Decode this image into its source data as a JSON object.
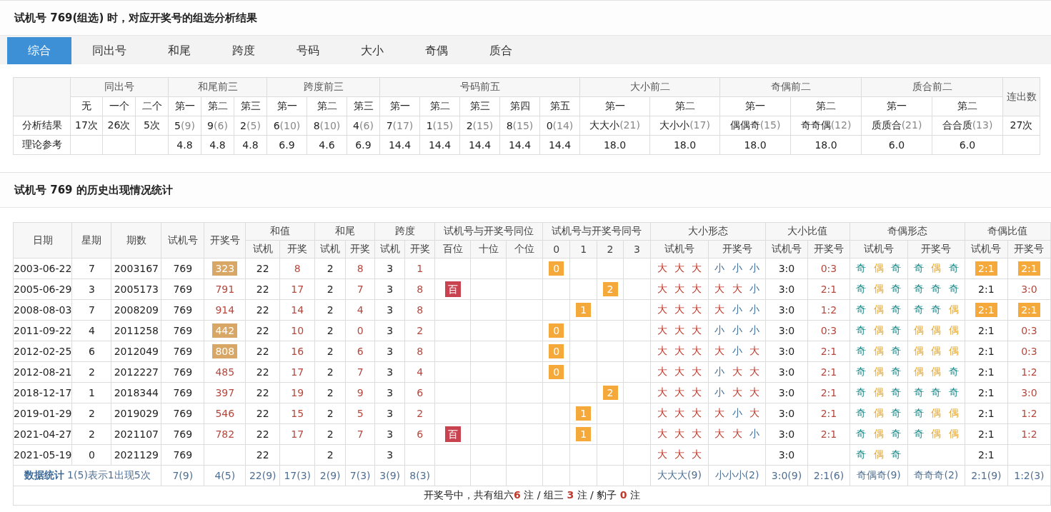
{
  "analysis": {
    "title": "试机号 769(组选) 时，对应开奖号的组选分析结果",
    "tabs": [
      {
        "label": "综合",
        "selected": true
      },
      {
        "label": "同出号",
        "selected": false
      },
      {
        "label": "和尾",
        "selected": false
      },
      {
        "label": "跨度",
        "selected": false
      },
      {
        "label": "号码",
        "selected": false
      },
      {
        "label": "大小",
        "selected": false
      },
      {
        "label": "奇偶",
        "selected": false
      },
      {
        "label": "质合",
        "selected": false
      }
    ],
    "groups": [
      {
        "label": "同出号",
        "columns": [
          "无",
          "一个",
          "二个"
        ]
      },
      {
        "label": "和尾前三",
        "columns": [
          "第一",
          "第二",
          "第三"
        ]
      },
      {
        "label": "跨度前三",
        "columns": [
          "第一",
          "第二",
          "第三"
        ]
      },
      {
        "label": "号码前五",
        "columns": [
          "第一",
          "第二",
          "第三",
          "第四",
          "第五"
        ]
      },
      {
        "label": "大小前二",
        "columns": [
          "第一",
          "第二"
        ]
      },
      {
        "label": "奇偶前二",
        "columns": [
          "第一",
          "第二"
        ]
      },
      {
        "label": "质合前二",
        "columns": [
          "第一",
          "第二"
        ]
      },
      {
        "label": "连出数"
      }
    ],
    "result_label": "分析结果",
    "theory_label": "理论参考",
    "results": [
      {
        "value": "17次"
      },
      {
        "value": "26次"
      },
      {
        "value": "5次"
      },
      {
        "value": "5",
        "count": "(9)",
        "theory": "4.8"
      },
      {
        "value": "9",
        "count": "(6)",
        "theory": "4.8"
      },
      {
        "value": "2",
        "count": "(5)",
        "theory": "4.8"
      },
      {
        "value": "6",
        "count": "(10)",
        "theory": "6.9"
      },
      {
        "value": "8",
        "count": "(10)",
        "theory": "4.6"
      },
      {
        "value": "4",
        "count": "(6)",
        "theory": "6.9"
      },
      {
        "value": "7",
        "count": "(17)",
        "theory": "14.4"
      },
      {
        "value": "1",
        "count": "(15)",
        "theory": "14.4"
      },
      {
        "value": "2",
        "count": "(15)",
        "theory": "14.4"
      },
      {
        "value": "8",
        "count": "(15)",
        "theory": "14.4"
      },
      {
        "value": "0",
        "count": "(14)",
        "theory": "14.4"
      },
      {
        "value": "大大小",
        "count": "(21)",
        "theory": "18.0"
      },
      {
        "value": "大小小",
        "count": "(17)",
        "theory": "18.0"
      },
      {
        "value": "偶偶奇",
        "count": "(15)",
        "theory": "18.0"
      },
      {
        "value": "奇奇偶",
        "count": "(12)",
        "theory": "18.0"
      },
      {
        "value": "质质合",
        "count": "(21)",
        "theory": "6.0"
      },
      {
        "value": "合合质",
        "count": "(13)",
        "theory": "6.0"
      },
      {
        "value": "27次"
      }
    ]
  },
  "history": {
    "title": "试机号 769 的历史出现情况统计",
    "header_groups": [
      {
        "label": "日期"
      },
      {
        "label": "星期"
      },
      {
        "label": "期数"
      },
      {
        "label": "试机号"
      },
      {
        "label": "开奖号"
      },
      {
        "label": "和值",
        "columns": [
          "试机",
          "开奖"
        ]
      },
      {
        "label": "和尾",
        "columns": [
          "试机",
          "开奖"
        ]
      },
      {
        "label": "跨度",
        "columns": [
          "试机",
          "开奖"
        ]
      },
      {
        "label": "试机号与开奖号同位",
        "columns": [
          "百位",
          "十位",
          "个位"
        ]
      },
      {
        "label": "试机号与开奖号同号",
        "columns": [
          "0",
          "1",
          "2",
          "3"
        ]
      },
      {
        "label": "大小形态",
        "columns": [
          "试机号",
          "开奖号"
        ]
      },
      {
        "label": "大小比值",
        "columns": [
          "试机号",
          "开奖号"
        ]
      },
      {
        "label": "奇偶形态",
        "columns": [
          "试机号",
          "开奖号"
        ]
      },
      {
        "label": "奇偶比值",
        "columns": [
          "试机号",
          "开奖号"
        ]
      }
    ],
    "rows": [
      {
        "date": "2003-06-22",
        "weekday": "7",
        "issue": "2003167",
        "trial": "769",
        "draw": {
          "text": "323",
          "highlight": true
        },
        "sum": {
          "trial": "22",
          "draw": "8"
        },
        "tail": {
          "trial": "2",
          "draw": "8"
        },
        "span": {
          "trial": "3",
          "draw": "1"
        },
        "same_number": {
          "zero": "0"
        },
        "size_trial": [
          {
            "text": "大",
            "kind": "big"
          },
          {
            "text": "大",
            "kind": "big"
          },
          {
            "text": "大",
            "kind": "big"
          }
        ],
        "size_draw": [
          {
            "text": "小",
            "kind": "small"
          },
          {
            "text": "小",
            "kind": "small"
          },
          {
            "text": "小",
            "kind": "small"
          }
        ],
        "size_ratio": {
          "trial": "3:0",
          "draw": "0:3"
        },
        "parity_trial": [
          {
            "text": "奇",
            "kind": "odd"
          },
          {
            "text": "偶",
            "kind": "even"
          },
          {
            "text": "奇",
            "kind": "odd"
          }
        ],
        "parity_draw": [
          {
            "text": "奇",
            "kind": "odd"
          },
          {
            "text": "偶",
            "kind": "even"
          },
          {
            "text": "奇",
            "kind": "odd"
          }
        ],
        "parity_ratio": {
          "trial": {
            "text": "2:1",
            "highlight": true
          },
          "draw": {
            "text": "2:1",
            "highlight": true
          }
        }
      },
      {
        "date": "2005-06-29",
        "weekday": "3",
        "issue": "2005173",
        "trial": "769",
        "draw": {
          "text": "791",
          "highlight": false
        },
        "sum": {
          "trial": "22",
          "draw": "17"
        },
        "tail": {
          "trial": "2",
          "draw": "7"
        },
        "span": {
          "trial": "3",
          "draw": "8"
        },
        "same_position": {
          "hundreds": "百"
        },
        "same_number": {
          "two": "2"
        },
        "size_trial": [
          {
            "text": "大",
            "kind": "big"
          },
          {
            "text": "大",
            "kind": "big"
          },
          {
            "text": "大",
            "kind": "big"
          }
        ],
        "size_draw": [
          {
            "text": "大",
            "kind": "big"
          },
          {
            "text": "大",
            "kind": "big"
          },
          {
            "text": "小",
            "kind": "small"
          }
        ],
        "size_ratio": {
          "trial": "3:0",
          "draw": "2:1"
        },
        "parity_trial": [
          {
            "text": "奇",
            "kind": "odd"
          },
          {
            "text": "偶",
            "kind": "even"
          },
          {
            "text": "奇",
            "kind": "odd"
          }
        ],
        "parity_draw": [
          {
            "text": "奇",
            "kind": "odd"
          },
          {
            "text": "奇",
            "kind": "odd"
          },
          {
            "text": "奇",
            "kind": "odd"
          }
        ],
        "parity_ratio": {
          "trial": {
            "text": "2:1",
            "highlight": false
          },
          "draw": {
            "text": "3:0",
            "highlight": false
          }
        }
      },
      {
        "date": "2008-08-03",
        "weekday": "7",
        "issue": "2008209",
        "trial": "769",
        "draw": {
          "text": "914",
          "highlight": false
        },
        "sum": {
          "trial": "22",
          "draw": "14"
        },
        "tail": {
          "trial": "2",
          "draw": "4"
        },
        "span": {
          "trial": "3",
          "draw": "8"
        },
        "same_number": {
          "one": "1"
        },
        "size_trial": [
          {
            "text": "大",
            "kind": "big"
          },
          {
            "text": "大",
            "kind": "big"
          },
          {
            "text": "大",
            "kind": "big"
          }
        ],
        "size_draw": [
          {
            "text": "大",
            "kind": "big"
          },
          {
            "text": "小",
            "kind": "small"
          },
          {
            "text": "小",
            "kind": "small"
          }
        ],
        "size_ratio": {
          "trial": "3:0",
          "draw": "1:2"
        },
        "parity_trial": [
          {
            "text": "奇",
            "kind": "odd"
          },
          {
            "text": "偶",
            "kind": "even"
          },
          {
            "text": "奇",
            "kind": "odd"
          }
        ],
        "parity_draw": [
          {
            "text": "奇",
            "kind": "odd"
          },
          {
            "text": "奇",
            "kind": "odd"
          },
          {
            "text": "偶",
            "kind": "even"
          }
        ],
        "parity_ratio": {
          "trial": {
            "text": "2:1",
            "highlight": true
          },
          "draw": {
            "text": "2:1",
            "highlight": true
          }
        }
      },
      {
        "date": "2011-09-22",
        "weekday": "4",
        "issue": "2011258",
        "trial": "769",
        "draw": {
          "text": "442",
          "highlight": true
        },
        "sum": {
          "trial": "22",
          "draw": "10"
        },
        "tail": {
          "trial": "2",
          "draw": "0"
        },
        "span": {
          "trial": "3",
          "draw": "2"
        },
        "same_number": {
          "zero": "0"
        },
        "size_trial": [
          {
            "text": "大",
            "kind": "big"
          },
          {
            "text": "大",
            "kind": "big"
          },
          {
            "text": "大",
            "kind": "big"
          }
        ],
        "size_draw": [
          {
            "text": "小",
            "kind": "small"
          },
          {
            "text": "小",
            "kind": "small"
          },
          {
            "text": "小",
            "kind": "small"
          }
        ],
        "size_ratio": {
          "trial": "3:0",
          "draw": "0:3"
        },
        "parity_trial": [
          {
            "text": "奇",
            "kind": "odd"
          },
          {
            "text": "偶",
            "kind": "even"
          },
          {
            "text": "奇",
            "kind": "odd"
          }
        ],
        "parity_draw": [
          {
            "text": "偶",
            "kind": "even"
          },
          {
            "text": "偶",
            "kind": "even"
          },
          {
            "text": "偶",
            "kind": "even"
          }
        ],
        "parity_ratio": {
          "trial": {
            "text": "2:1",
            "highlight": false
          },
          "draw": {
            "text": "0:3",
            "highlight": false
          }
        }
      },
      {
        "date": "2012-02-25",
        "weekday": "6",
        "issue": "2012049",
        "trial": "769",
        "draw": {
          "text": "808",
          "highlight": true
        },
        "sum": {
          "trial": "22",
          "draw": "16"
        },
        "tail": {
          "trial": "2",
          "draw": "6"
        },
        "span": {
          "trial": "3",
          "draw": "8"
        },
        "same_number": {
          "zero": "0"
        },
        "size_trial": [
          {
            "text": "大",
            "kind": "big"
          },
          {
            "text": "大",
            "kind": "big"
          },
          {
            "text": "大",
            "kind": "big"
          }
        ],
        "size_draw": [
          {
            "text": "大",
            "kind": "big"
          },
          {
            "text": "小",
            "kind": "small"
          },
          {
            "text": "大",
            "kind": "big"
          }
        ],
        "size_ratio": {
          "trial": "3:0",
          "draw": "2:1"
        },
        "parity_trial": [
          {
            "text": "奇",
            "kind": "odd"
          },
          {
            "text": "偶",
            "kind": "even"
          },
          {
            "text": "奇",
            "kind": "odd"
          }
        ],
        "parity_draw": [
          {
            "text": "偶",
            "kind": "even"
          },
          {
            "text": "偶",
            "kind": "even"
          },
          {
            "text": "偶",
            "kind": "even"
          }
        ],
        "parity_ratio": {
          "trial": {
            "text": "2:1",
            "highlight": false
          },
          "draw": {
            "text": "0:3",
            "highlight": false
          }
        }
      },
      {
        "date": "2012-08-21",
        "weekday": "2",
        "issue": "2012227",
        "trial": "769",
        "draw": {
          "text": "485",
          "highlight": false
        },
        "sum": {
          "trial": "22",
          "draw": "17"
        },
        "tail": {
          "trial": "2",
          "draw": "7"
        },
        "span": {
          "trial": "3",
          "draw": "4"
        },
        "same_number": {
          "zero": "0"
        },
        "size_trial": [
          {
            "text": "大",
            "kind": "big"
          },
          {
            "text": "大",
            "kind": "big"
          },
          {
            "text": "大",
            "kind": "big"
          }
        ],
        "size_draw": [
          {
            "text": "小",
            "kind": "small"
          },
          {
            "text": "大",
            "kind": "big"
          },
          {
            "text": "大",
            "kind": "big"
          }
        ],
        "size_ratio": {
          "trial": "3:0",
          "draw": "2:1"
        },
        "parity_trial": [
          {
            "text": "奇",
            "kind": "odd"
          },
          {
            "text": "偶",
            "kind": "even"
          },
          {
            "text": "奇",
            "kind": "odd"
          }
        ],
        "parity_draw": [
          {
            "text": "偶",
            "kind": "even"
          },
          {
            "text": "偶",
            "kind": "even"
          },
          {
            "text": "奇",
            "kind": "odd"
          }
        ],
        "parity_ratio": {
          "trial": {
            "text": "2:1",
            "highlight": false
          },
          "draw": {
            "text": "1:2",
            "highlight": false
          }
        }
      },
      {
        "date": "2018-12-17",
        "weekday": "1",
        "issue": "2018344",
        "trial": "769",
        "draw": {
          "text": "397",
          "highlight": false
        },
        "sum": {
          "trial": "22",
          "draw": "19"
        },
        "tail": {
          "trial": "2",
          "draw": "9"
        },
        "span": {
          "trial": "3",
          "draw": "6"
        },
        "same_number": {
          "two": "2"
        },
        "size_trial": [
          {
            "text": "大",
            "kind": "big"
          },
          {
            "text": "大",
            "kind": "big"
          },
          {
            "text": "大",
            "kind": "big"
          }
        ],
        "size_draw": [
          {
            "text": "小",
            "kind": "small"
          },
          {
            "text": "大",
            "kind": "big"
          },
          {
            "text": "大",
            "kind": "big"
          }
        ],
        "size_ratio": {
          "trial": "3:0",
          "draw": "2:1"
        },
        "parity_trial": [
          {
            "text": "奇",
            "kind": "odd"
          },
          {
            "text": "偶",
            "kind": "even"
          },
          {
            "text": "奇",
            "kind": "odd"
          }
        ],
        "parity_draw": [
          {
            "text": "奇",
            "kind": "odd"
          },
          {
            "text": "奇",
            "kind": "odd"
          },
          {
            "text": "奇",
            "kind": "odd"
          }
        ],
        "parity_ratio": {
          "trial": {
            "text": "2:1",
            "highlight": false
          },
          "draw": {
            "text": "3:0",
            "highlight": false
          }
        }
      },
      {
        "date": "2019-01-29",
        "weekday": "2",
        "issue": "2019029",
        "trial": "769",
        "draw": {
          "text": "546",
          "highlight": false
        },
        "sum": {
          "trial": "22",
          "draw": "15"
        },
        "tail": {
          "trial": "2",
          "draw": "5"
        },
        "span": {
          "trial": "3",
          "draw": "2"
        },
        "same_number": {
          "one": "1"
        },
        "size_trial": [
          {
            "text": "大",
            "kind": "big"
          },
          {
            "text": "大",
            "kind": "big"
          },
          {
            "text": "大",
            "kind": "big"
          }
        ],
        "size_draw": [
          {
            "text": "大",
            "kind": "big"
          },
          {
            "text": "小",
            "kind": "small"
          },
          {
            "text": "大",
            "kind": "big"
          }
        ],
        "size_ratio": {
          "trial": "3:0",
          "draw": "2:1"
        },
        "parity_trial": [
          {
            "text": "奇",
            "kind": "odd"
          },
          {
            "text": "偶",
            "kind": "even"
          },
          {
            "text": "奇",
            "kind": "odd"
          }
        ],
        "parity_draw": [
          {
            "text": "奇",
            "kind": "odd"
          },
          {
            "text": "偶",
            "kind": "even"
          },
          {
            "text": "偶",
            "kind": "even"
          }
        ],
        "parity_ratio": {
          "trial": {
            "text": "2:1",
            "highlight": false
          },
          "draw": {
            "text": "1:2",
            "highlight": false
          }
        }
      },
      {
        "date": "2021-04-27",
        "weekday": "2",
        "issue": "2021107",
        "trial": "769",
        "draw": {
          "text": "782",
          "highlight": false
        },
        "sum": {
          "trial": "22",
          "draw": "17"
        },
        "tail": {
          "trial": "2",
          "draw": "7"
        },
        "span": {
          "trial": "3",
          "draw": "6"
        },
        "same_position": {
          "hundreds": "百"
        },
        "same_number": {
          "one": "1"
        },
        "size_trial": [
          {
            "text": "大",
            "kind": "big"
          },
          {
            "text": "大",
            "kind": "big"
          },
          {
            "text": "大",
            "kind": "big"
          }
        ],
        "size_draw": [
          {
            "text": "大",
            "kind": "big"
          },
          {
            "text": "大",
            "kind": "big"
          },
          {
            "text": "小",
            "kind": "small"
          }
        ],
        "size_ratio": {
          "trial": "3:0",
          "draw": "2:1"
        },
        "parity_trial": [
          {
            "text": "奇",
            "kind": "odd"
          },
          {
            "text": "偶",
            "kind": "even"
          },
          {
            "text": "奇",
            "kind": "odd"
          }
        ],
        "parity_draw": [
          {
            "text": "奇",
            "kind": "odd"
          },
          {
            "text": "偶",
            "kind": "even"
          },
          {
            "text": "偶",
            "kind": "even"
          }
        ],
        "parity_ratio": {
          "trial": {
            "text": "2:1",
            "highlight": false
          },
          "draw": {
            "text": "1:2",
            "highlight": false
          }
        }
      },
      {
        "date": "2021-05-19",
        "weekday": "0",
        "issue": "2021129",
        "trial": "769",
        "sum": {
          "trial": "22"
        },
        "tail": {
          "trial": "2"
        },
        "span": {
          "trial": "3"
        },
        "size_trial": [
          {
            "text": "大",
            "kind": "big"
          },
          {
            "text": "大",
            "kind": "big"
          },
          {
            "text": "大",
            "kind": "big"
          }
        ],
        "size_ratio": {
          "trial": "3:0"
        },
        "parity_trial": [
          {
            "text": "奇",
            "kind": "odd"
          },
          {
            "text": "偶",
            "kind": "even"
          },
          {
            "text": "奇",
            "kind": "odd"
          }
        ],
        "parity_ratio": {
          "trial": {
            "text": "2:1",
            "highlight": false
          }
        }
      }
    ],
    "stats": {
      "label": "数据统计",
      "note": "1(5)表示1出现5次",
      "before": [
        "7(9)",
        "4(5)",
        "22(9)",
        "17(3)",
        "2(9)",
        "7(3)",
        "3(9)",
        "8(3)"
      ],
      "after": [
        "大大大(9)",
        "小小小(2)",
        "3:0(9)",
        "2:1(6)",
        "奇偶奇(9)",
        "奇奇奇(2)",
        "2:1(9)",
        "1:2(3)"
      ]
    },
    "summary": "开奖号中，共有组六**6** 注 / 组三 **3** 注 / 豹子 **0** 注"
  }
}
